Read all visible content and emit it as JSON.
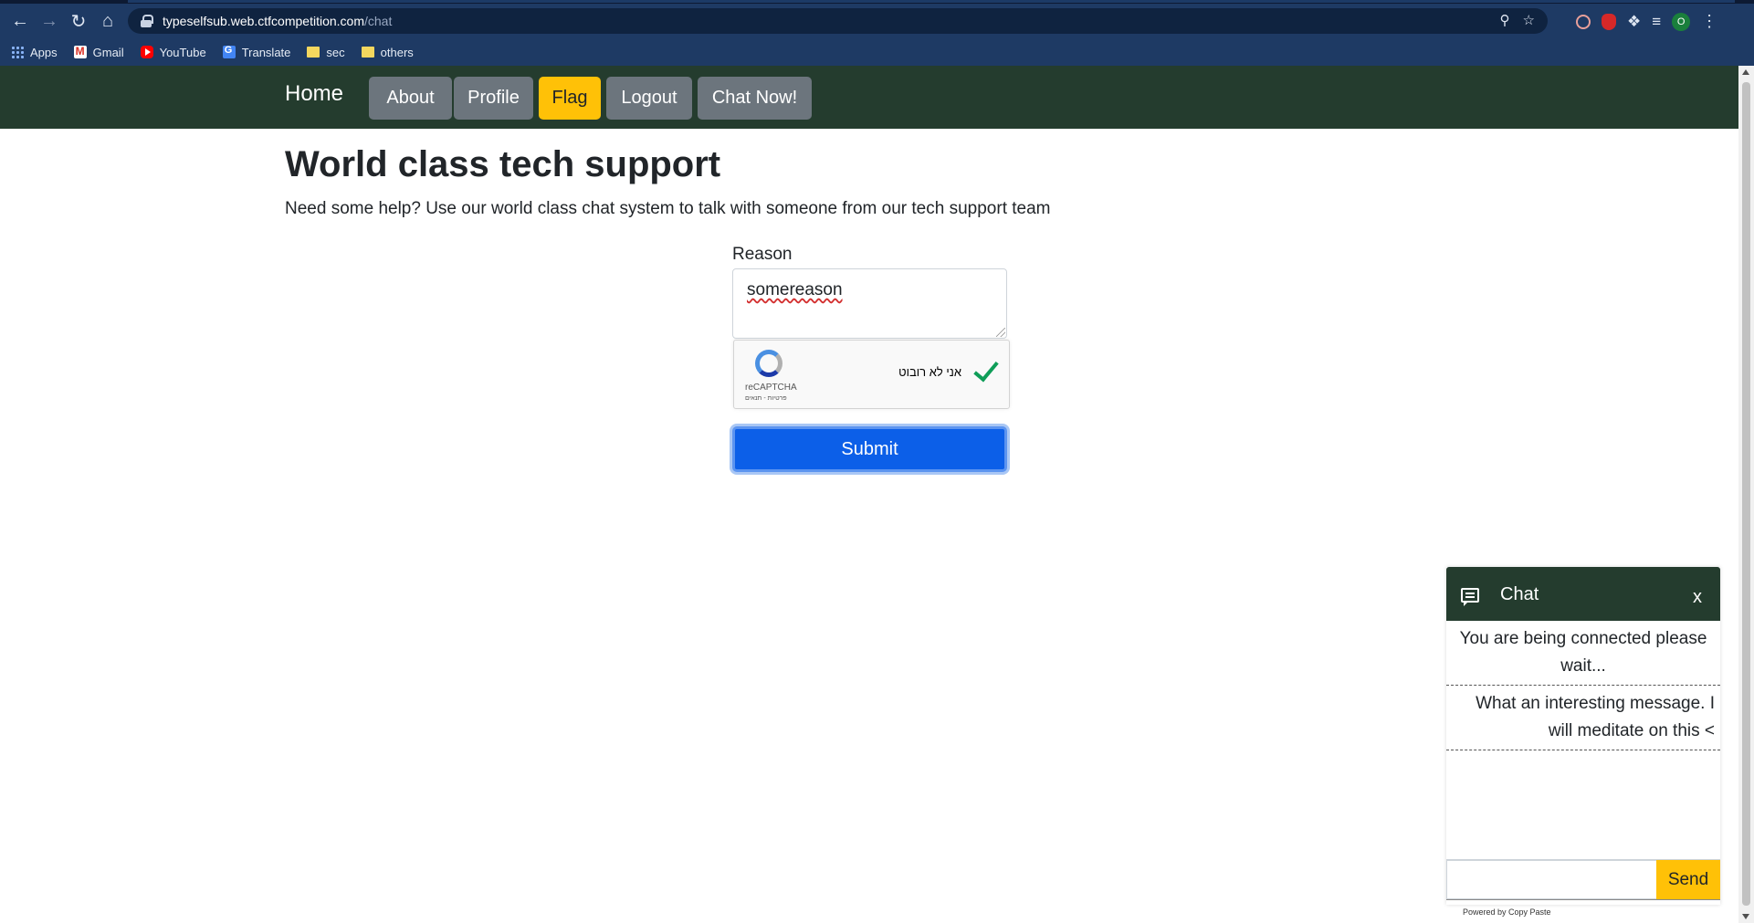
{
  "browser": {
    "url_host": "typeselfsub.web.ctfcompetition.com",
    "url_path": "/chat",
    "profile_initial": "O",
    "bookmarks": [
      {
        "label": "Apps",
        "icon": "apps-grid-icon"
      },
      {
        "label": "Gmail",
        "icon": "gmail-icon"
      },
      {
        "label": "YouTube",
        "icon": "youtube-icon"
      },
      {
        "label": "Translate",
        "icon": "translate-icon"
      },
      {
        "label": "sec",
        "icon": "folder-icon"
      },
      {
        "label": "others",
        "icon": "folder-icon"
      }
    ]
  },
  "nav": {
    "brand": "Home",
    "items": [
      "About",
      "Profile",
      "Flag",
      "Logout",
      "Chat Now!"
    ],
    "bg_color": "#243c2e",
    "active_color": "#ffc107"
  },
  "main": {
    "title": "World class tech support",
    "lead": "Need some help? Use our world class chat system to talk with someone from our tech support team",
    "reason_label": "Reason",
    "reason_value": "somereason",
    "recaptcha_label": "אני לא רובוט",
    "recaptcha_brand": "reCAPTCHA",
    "recaptcha_terms": "פרטיות - תנאים",
    "recaptcha_checked": true,
    "submit_label": "Submit",
    "submit_color": "#0c5fe8"
  },
  "chat": {
    "title": "Chat",
    "close_label": "x",
    "messages": [
      "You are being connected please wait...",
      "What an interesting message. I will meditate on this <"
    ],
    "input_value": "",
    "send_label": "Send",
    "powered_by": "Powered by Copy Paste"
  }
}
